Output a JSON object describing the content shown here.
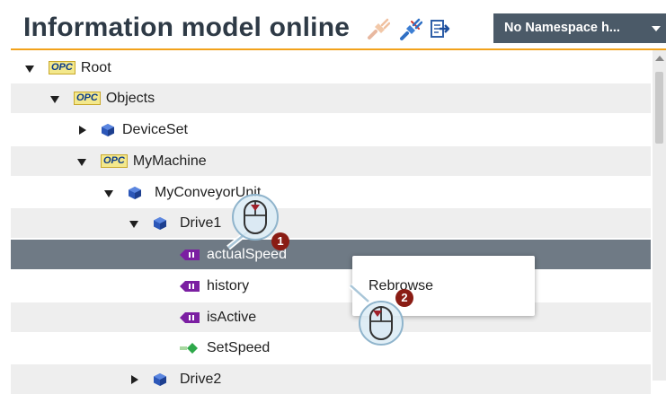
{
  "header": {
    "title": "Information model online",
    "namespace_dropdown": "No Namespace h...",
    "icons": [
      "disconnect-icon",
      "connect-icon",
      "export-icon"
    ]
  },
  "tree": {
    "rows": [
      {
        "label": "Root",
        "expand": "down",
        "icon": "opc-folder-icon",
        "icon_text": "OPC"
      },
      {
        "label": "Objects",
        "expand": "down",
        "icon": "opc-folder-icon",
        "icon_text": "OPC"
      },
      {
        "label": "DeviceSet",
        "expand": "right",
        "icon": "object-cube-icon"
      },
      {
        "label": "MyMachine",
        "expand": "down",
        "icon": "opc-folder-icon",
        "icon_text": "OPC"
      },
      {
        "label": "MyConveyorUnit",
        "expand": "down",
        "icon": "object-cube-icon"
      },
      {
        "label": "Drive1",
        "expand": "down",
        "icon": "object-cube-icon"
      },
      {
        "label": "actualSpeed",
        "expand": "none",
        "icon": "variable-icon",
        "selected": true
      },
      {
        "label": "history",
        "expand": "none",
        "icon": "variable-icon"
      },
      {
        "label": "isActive",
        "expand": "none",
        "icon": "variable-icon"
      },
      {
        "label": "SetSpeed",
        "expand": "none",
        "icon": "method-icon"
      },
      {
        "label": "Drive2",
        "expand": "right",
        "icon": "object-cube-icon"
      }
    ]
  },
  "context_menu": {
    "items": [
      "Rebrowse"
    ]
  },
  "callouts": {
    "step1": "1",
    "step2": "2"
  },
  "colors": {
    "accent_orange": "#f2a21b",
    "selected_row": "#6f7a85",
    "dropdown_bg": "#4b5a68",
    "callout_red": "#8a1c14"
  }
}
